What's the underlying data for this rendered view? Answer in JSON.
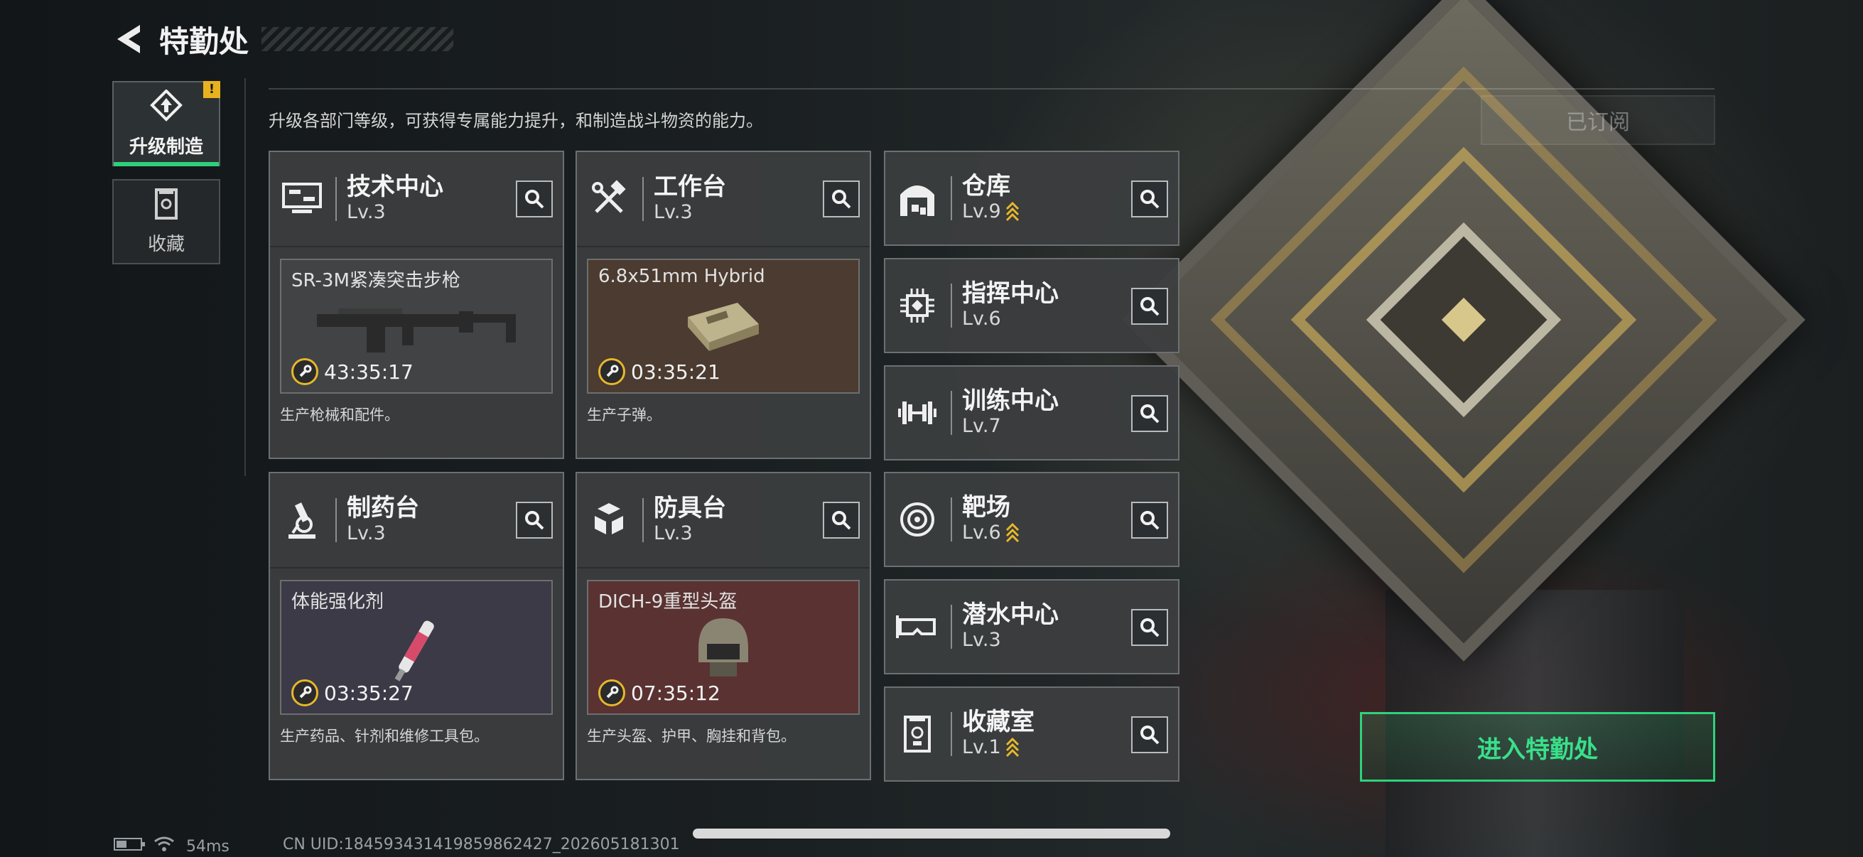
{
  "header": {
    "title": "特勤处"
  },
  "sidebar": {
    "tabs": [
      {
        "label": "升级制造",
        "active": true,
        "badge": "!"
      },
      {
        "label": "收藏",
        "active": false
      }
    ]
  },
  "main": {
    "description": "升级各部门等级，可获得专属能力提升，和制造战斗物资的能力。",
    "subscribed_label": "已订阅",
    "departments": [
      {
        "name": "技术中心",
        "level": "Lv.3",
        "item": "SR-3M紧凑突击步枪",
        "timer": "43:35:17",
        "desc": "生产枪械和配件。",
        "item_bg": "#414345"
      },
      {
        "name": "工作台",
        "level": "Lv.3",
        "item": "6.8x51mm Hybrid",
        "timer": "03:35:21",
        "desc": "生产子弹。",
        "item_bg": "#4b3b30"
      },
      {
        "name": "制药台",
        "level": "Lv.3",
        "item": "体能强化剂",
        "timer": "03:35:27",
        "desc": "生产药品、针剂和维修工具包。",
        "item_bg": "#3d3a47"
      },
      {
        "name": "防具台",
        "level": "Lv.3",
        "item": "DICH-9重型头盔",
        "timer": "07:35:12",
        "desc": "生产头盔、护甲、胸挂和背包。",
        "item_bg": "#5a3232"
      }
    ],
    "facilities": [
      {
        "name": "仓库",
        "level": "Lv.9",
        "upgradable": true,
        "icon": "warehouse-icon"
      },
      {
        "name": "指挥中心",
        "level": "Lv.6",
        "upgradable": false,
        "icon": "command-chip-icon"
      },
      {
        "name": "训练中心",
        "level": "Lv.7",
        "upgradable": false,
        "icon": "dumbbell-icon"
      },
      {
        "name": "靶场",
        "level": "Lv.6",
        "upgradable": true,
        "icon": "target-icon"
      },
      {
        "name": "潜水中心",
        "level": "Lv.3",
        "upgradable": false,
        "icon": "diving-mask-icon"
      },
      {
        "name": "收藏室",
        "level": "Lv.1",
        "upgradable": true,
        "icon": "trophy-case-icon"
      }
    ]
  },
  "enter_button": {
    "label": "进入特勤处"
  },
  "status_bar": {
    "ping": "54ms",
    "uid": "CN UID:1845934314198598​62427_202605181301"
  },
  "colors": {
    "accent_green": "#2fd27c",
    "upgrade_gold": "#e6b82a",
    "warning": "#e8b21f"
  }
}
